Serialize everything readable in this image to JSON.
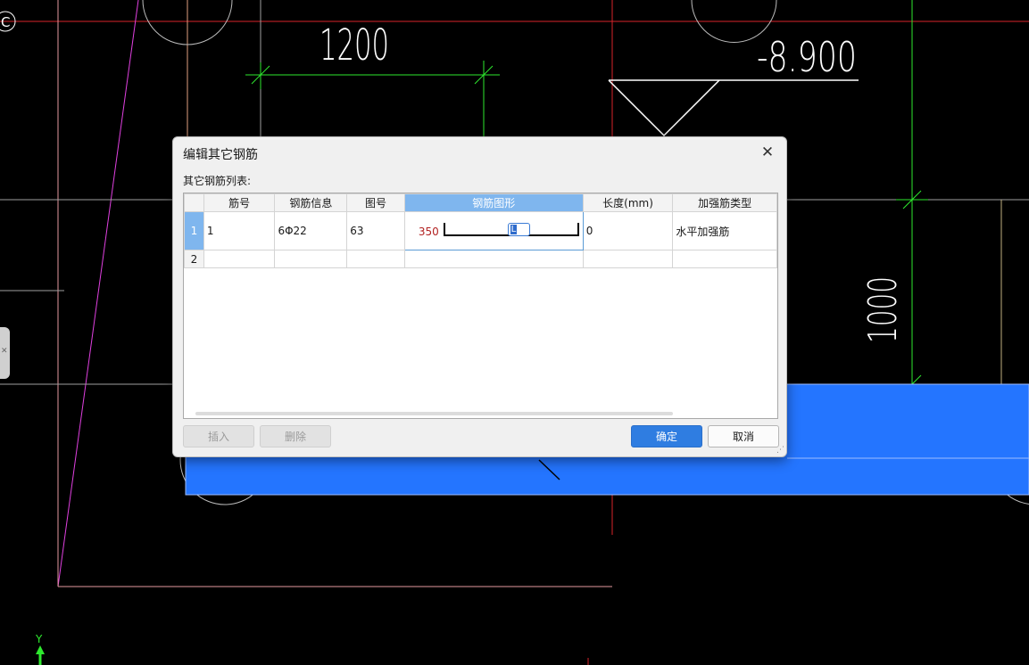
{
  "cad": {
    "dim_top": "1200",
    "elevation": "-8.900",
    "dim_right": "1000",
    "corner_label": "C",
    "axis_y": "Y"
  },
  "dialog": {
    "title": "编辑其它钢筋",
    "list_label": "其它钢筋列表:",
    "columns": [
      "",
      "筋号",
      "钢筋信息",
      "图号",
      "钢筋图形",
      "长度(mm)",
      "加强筋类型"
    ],
    "selected_column": 4,
    "rows": [
      {
        "index": "1",
        "bar_no": "1",
        "bar_info": "6Φ22",
        "shape_no": "63",
        "shape_value": "350",
        "shape_editor": "L",
        "length": "0",
        "type": "水平加强筋"
      },
      {
        "index": "2",
        "bar_no": "",
        "bar_info": "",
        "shape_no": "",
        "shape_value": "",
        "shape_editor": "",
        "length": "",
        "type": ""
      }
    ],
    "buttons": {
      "insert": "插入",
      "delete": "删除",
      "ok": "确定",
      "cancel": "取消"
    }
  },
  "colors": {
    "background": "#000000",
    "highlight_blue": "#2475ff",
    "selection": "#7fb6ee",
    "annotation_arrow": "#e8332a"
  }
}
